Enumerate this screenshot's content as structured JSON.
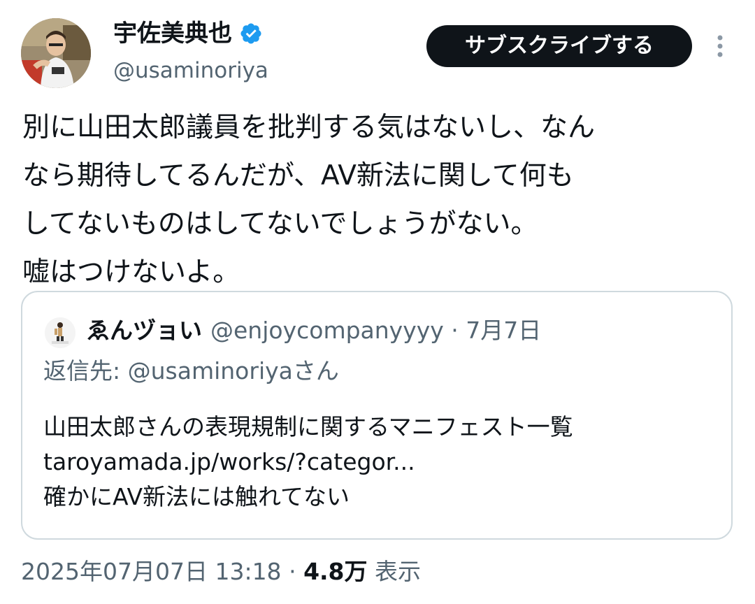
{
  "author": {
    "display_name": "宇佐美典也",
    "handle": "@usaminoriya",
    "verified_icon": "verified-badge-icon",
    "verified_color": "#1d9bf0"
  },
  "actions": {
    "subscribe_label": "サブスクライブする",
    "more_icon": "more-vertical-icon"
  },
  "tweet": {
    "lines": [
      "別に山田太郎議員を批判する気はないし、なん",
      "なら期待してるんだが、AV新法に関して何も",
      "してないものはしてないでしょうがない。",
      "嘘はつけないよ。"
    ]
  },
  "quote": {
    "display_name": "ゑんヅョい",
    "handle": "@enjoycompanyyyy",
    "separator": "·",
    "date": "7月7日",
    "reply_prefix": "返信先:",
    "reply_handle": "@usaminoriyaさん",
    "body_lines": [
      "山田太郎さんの表現規制に関するマニフェスト一覧",
      "taroyamada.jp/works/?categor...",
      "確かにAV新法には触れてない"
    ]
  },
  "meta": {
    "timestamp": "2025年07月07日 13:18",
    "separator": "·",
    "view_count": "4.8万",
    "view_label": "表示"
  },
  "colors": {
    "text_primary": "#0f1419",
    "text_secondary": "#536471",
    "border": "#cfd9de",
    "button_bg": "#0f1419"
  }
}
